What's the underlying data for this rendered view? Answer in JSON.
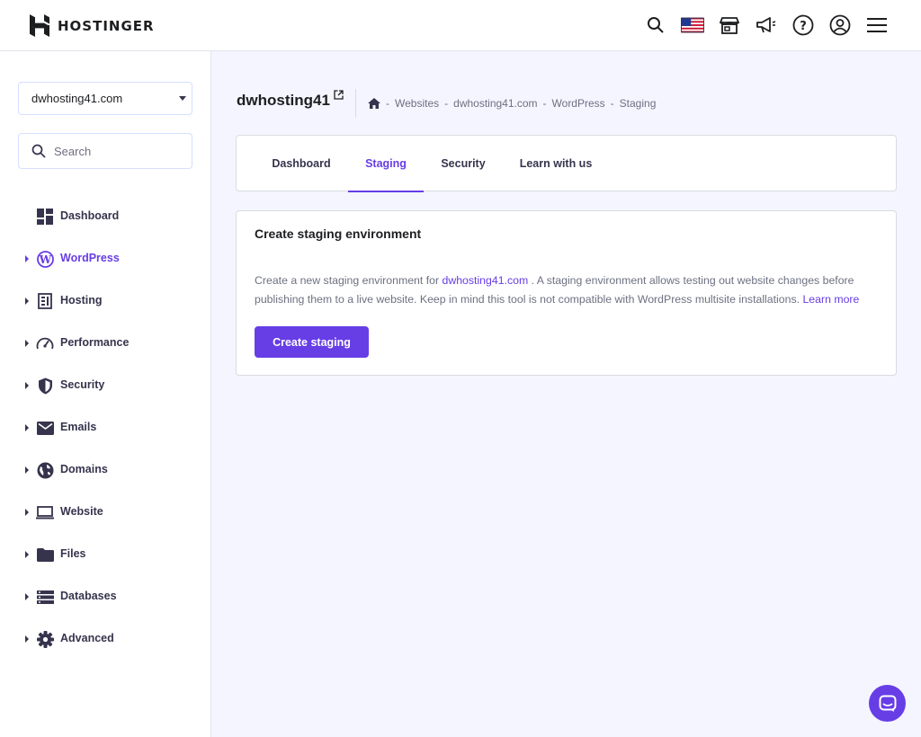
{
  "header": {
    "brand": "HOSTINGER",
    "icons": [
      "search-icon",
      "us-flag-icon",
      "store-icon",
      "megaphone-icon",
      "help-icon",
      "account-icon",
      "menu-icon"
    ]
  },
  "sidebar": {
    "site_select": {
      "value": "dwhosting41.com"
    },
    "search": {
      "placeholder": "Search"
    },
    "items": [
      {
        "label": "Dashboard",
        "icon": "dashboard-icon",
        "expandable": false,
        "active": false
      },
      {
        "label": "WordPress",
        "icon": "wordpress-icon",
        "expandable": true,
        "active": true
      },
      {
        "label": "Hosting",
        "icon": "hosting-icon",
        "expandable": true,
        "active": false
      },
      {
        "label": "Performance",
        "icon": "performance-icon",
        "expandable": true,
        "active": false
      },
      {
        "label": "Security",
        "icon": "shield-icon",
        "expandable": true,
        "active": false
      },
      {
        "label": "Emails",
        "icon": "email-icon",
        "expandable": true,
        "active": false
      },
      {
        "label": "Domains",
        "icon": "globe-icon",
        "expandable": true,
        "active": false
      },
      {
        "label": "Website",
        "icon": "laptop-icon",
        "expandable": true,
        "active": false
      },
      {
        "label": "Files",
        "icon": "folder-icon",
        "expandable": true,
        "active": false
      },
      {
        "label": "Databases",
        "icon": "database-icon",
        "expandable": true,
        "active": false
      },
      {
        "label": "Advanced",
        "icon": "gear-icon",
        "expandable": true,
        "active": false
      }
    ]
  },
  "main": {
    "title": "dwhosting41",
    "breadcrumb": [
      "Websites",
      "dwhosting41.com",
      "WordPress",
      "Staging"
    ],
    "breadcrumb_separator": "-",
    "tabs": [
      {
        "label": "Dashboard",
        "active": false
      },
      {
        "label": "Staging",
        "active": true
      },
      {
        "label": "Security",
        "active": false
      },
      {
        "label": "Learn with us",
        "active": false
      }
    ],
    "card": {
      "title": "Create staging environment",
      "desc_before": "Create a new staging environment for",
      "desc_domain": "dwhosting41.com",
      "desc_after": ". A staging environment allows testing out website changes before publishing them to a live website. Keep in mind this tool is not compatible with WordPress multisite installations.",
      "learn_more": "Learn more",
      "button_label": "Create staging"
    }
  },
  "colors": {
    "accent": "#673de6",
    "text_dark": "#1d1e20",
    "text_nav": "#36344d",
    "text_muted": "#6d7081",
    "background": "#f4f5ff"
  }
}
